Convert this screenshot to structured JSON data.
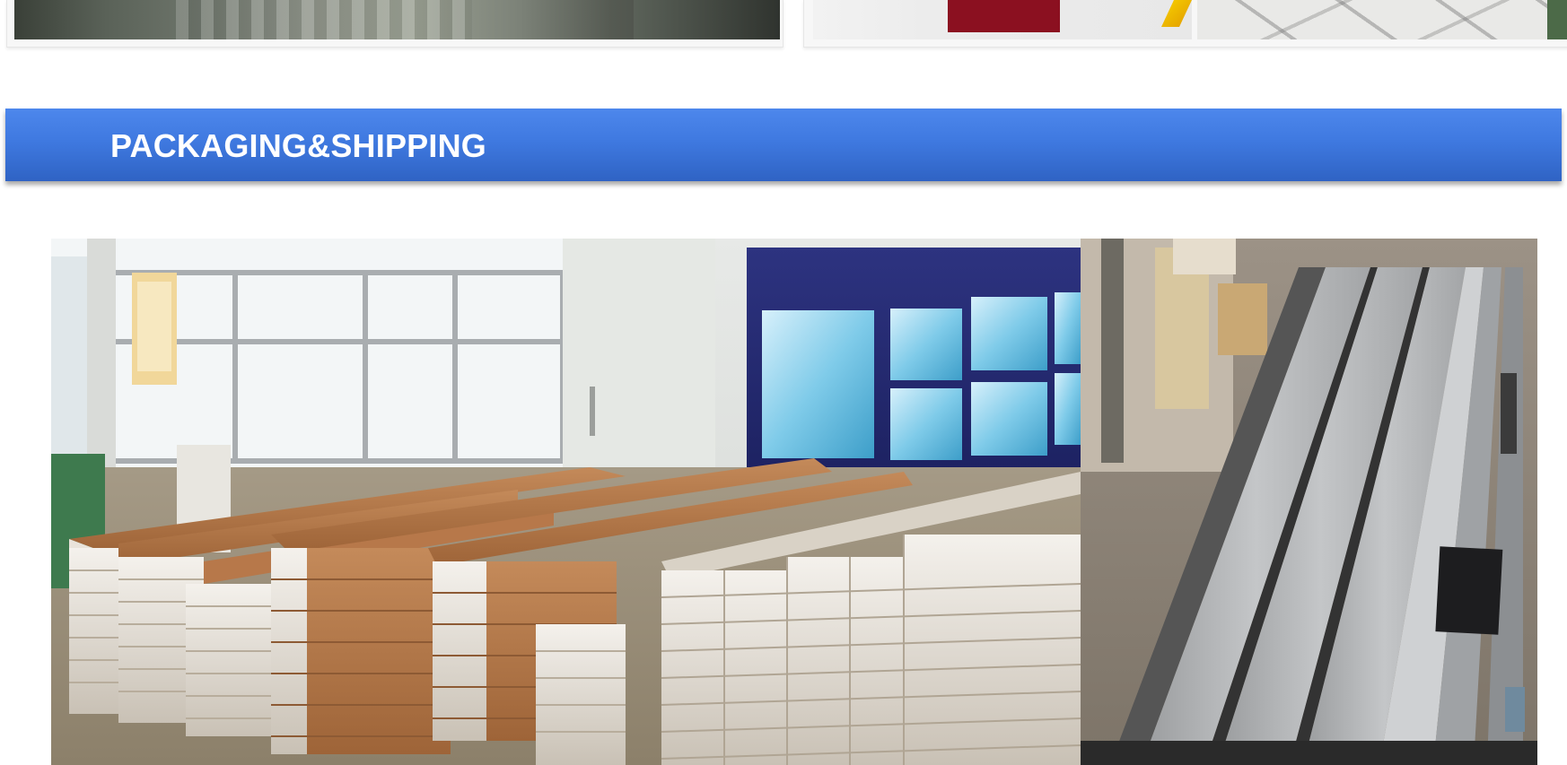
{
  "section": {
    "title": "PACKAGING&SHIPPING"
  },
  "images": {
    "top_left": "factory-floor-photo",
    "top_right_1": "product-photo",
    "top_right_2": "tile-floor-photo",
    "main": "packaged-aluminum-profiles-photo"
  },
  "colors": {
    "section_bar": "#3f79e0",
    "section_title": "#ffffff",
    "page_background": "#ffffff"
  }
}
